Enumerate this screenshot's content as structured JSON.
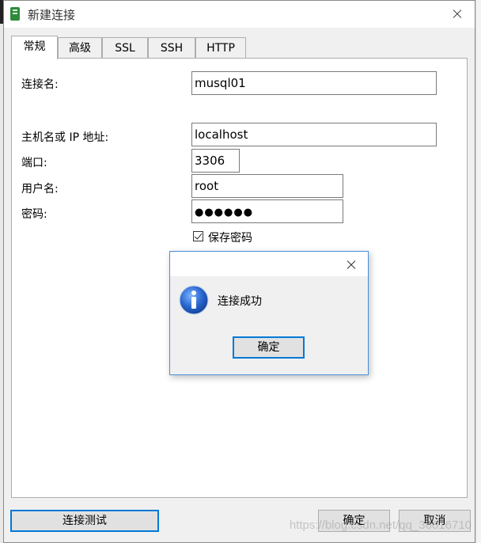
{
  "window": {
    "title": "新建连接"
  },
  "tabs": [
    {
      "label": "常规",
      "active": true
    },
    {
      "label": "高级",
      "active": false
    },
    {
      "label": "SSL",
      "active": false
    },
    {
      "label": "SSH",
      "active": false
    },
    {
      "label": "HTTP",
      "active": false
    }
  ],
  "form": {
    "connection_name_label": "连接名:",
    "connection_name_value": "musql01",
    "host_label": "主机名或 IP 地址:",
    "host_value": "localhost",
    "port_label": "端口:",
    "port_value": "3306",
    "user_label": "用户名:",
    "user_value": "root",
    "password_label": "密码:",
    "password_value": "●●●●●●",
    "save_password_label": "保存密码",
    "save_password_checked": true
  },
  "footer": {
    "test_button": "连接测试",
    "ok_button": "确定",
    "cancel_button": "取消"
  },
  "watermark": "https://blog.csdn.net/qq_36016710",
  "dialog": {
    "message": "连接成功",
    "ok_button": "确定"
  },
  "colors": {
    "focus_border": "#0078d7",
    "app_icon": "#2e8b3a",
    "info_icon": "#1e5bbf"
  }
}
